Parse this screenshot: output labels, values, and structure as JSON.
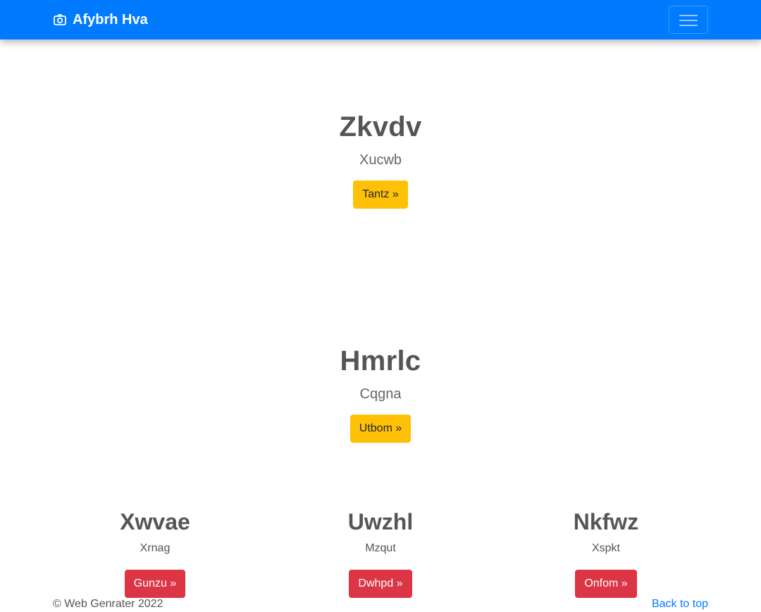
{
  "navbar": {
    "brand": "Afybrh Hva",
    "brand_icon": "camera-icon",
    "toggler_icon": "hamburger-menu-icon",
    "background": "#007bff"
  },
  "heroes": [
    {
      "title": "Zkvdv",
      "subtitle": "Xucwb",
      "button": "Tantz »"
    },
    {
      "title": "Hmrlc",
      "subtitle": "Cqgna",
      "button": "Utbom »"
    }
  ],
  "columns": [
    {
      "title": "Xwvae",
      "text": "Xrnag",
      "button": "Gunzu »"
    },
    {
      "title": "Uwzhl",
      "text": "Mzqut",
      "button": "Dwhpd »"
    },
    {
      "title": "Nkfwz",
      "text": "Xspkt",
      "button": "Onfom »"
    }
  ],
  "footer": {
    "copyright": "© Web Genrater 2022",
    "back_to_top": "Back to top"
  },
  "colors": {
    "warning": "#ffc107",
    "danger": "#dc3545",
    "link": "#007bff"
  }
}
